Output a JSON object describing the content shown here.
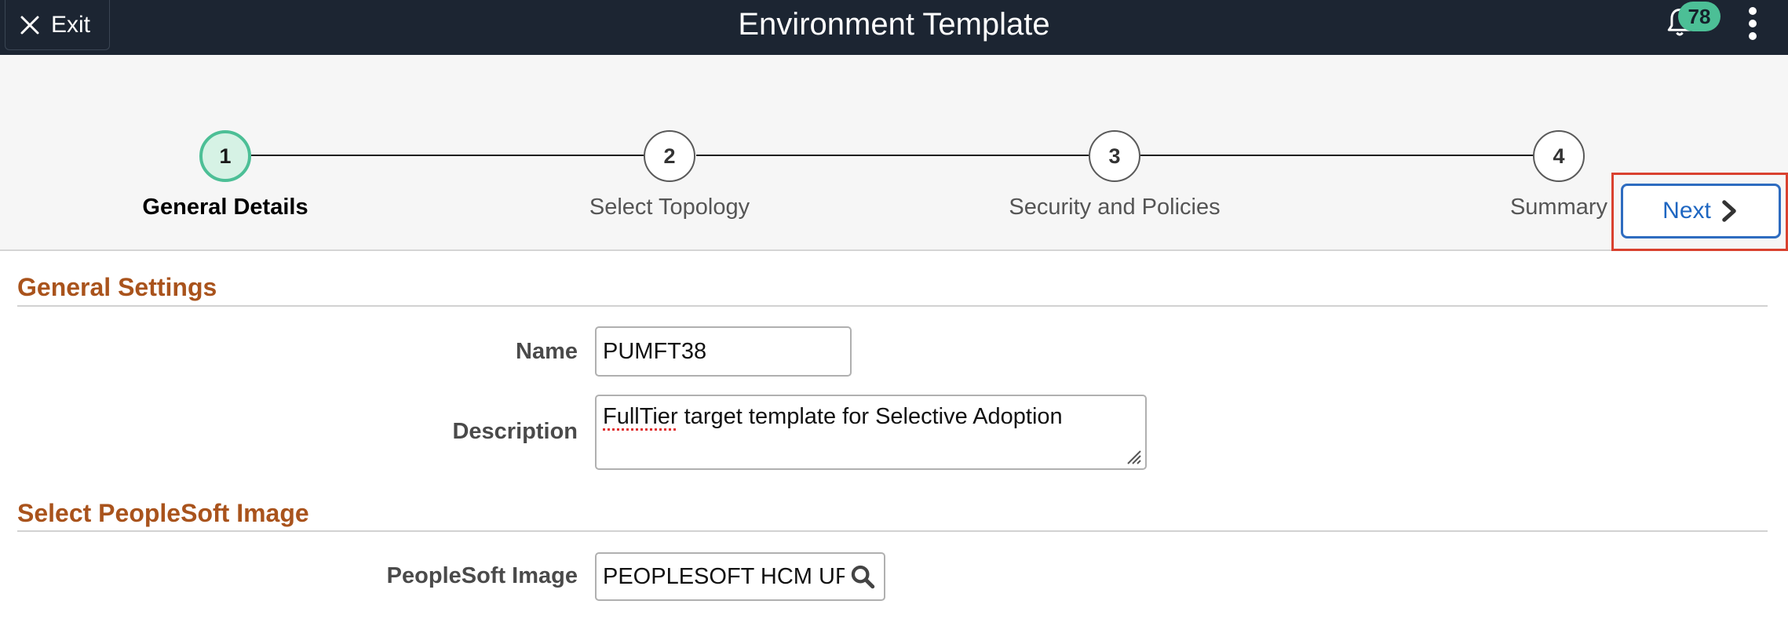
{
  "header": {
    "exit_label": "Exit",
    "title": "Environment Template",
    "notification_count": "78",
    "icons": [
      "close-icon",
      "bell-icon",
      "more-vertical-icon"
    ]
  },
  "train": {
    "steps": [
      {
        "number": "1",
        "label": "General Details",
        "active": true
      },
      {
        "number": "2",
        "label": "Select Topology",
        "active": false
      },
      {
        "number": "3",
        "label": "Security and Policies",
        "active": false
      },
      {
        "number": "4",
        "label": "Summary",
        "active": false
      }
    ],
    "next_label": "Next"
  },
  "general_settings": {
    "title": "General Settings",
    "name_label": "Name",
    "name_value": "PUMFT38",
    "description_label": "Description",
    "description_value_underlined": "FullTier",
    "description_value_rest": " target template for Selective Adoption"
  },
  "image_section": {
    "title": "Select PeopleSoft Image",
    "image_label": "PeopleSoft Image",
    "image_value": "PEOPLESOFT HCM UPDATE IMAGE"
  },
  "colors": {
    "header_bg": "#1c2532",
    "section_title": "#a9531c",
    "active_step": "#4cbf96",
    "link_blue": "#1e66c1",
    "highlight_red": "#d9412f"
  }
}
